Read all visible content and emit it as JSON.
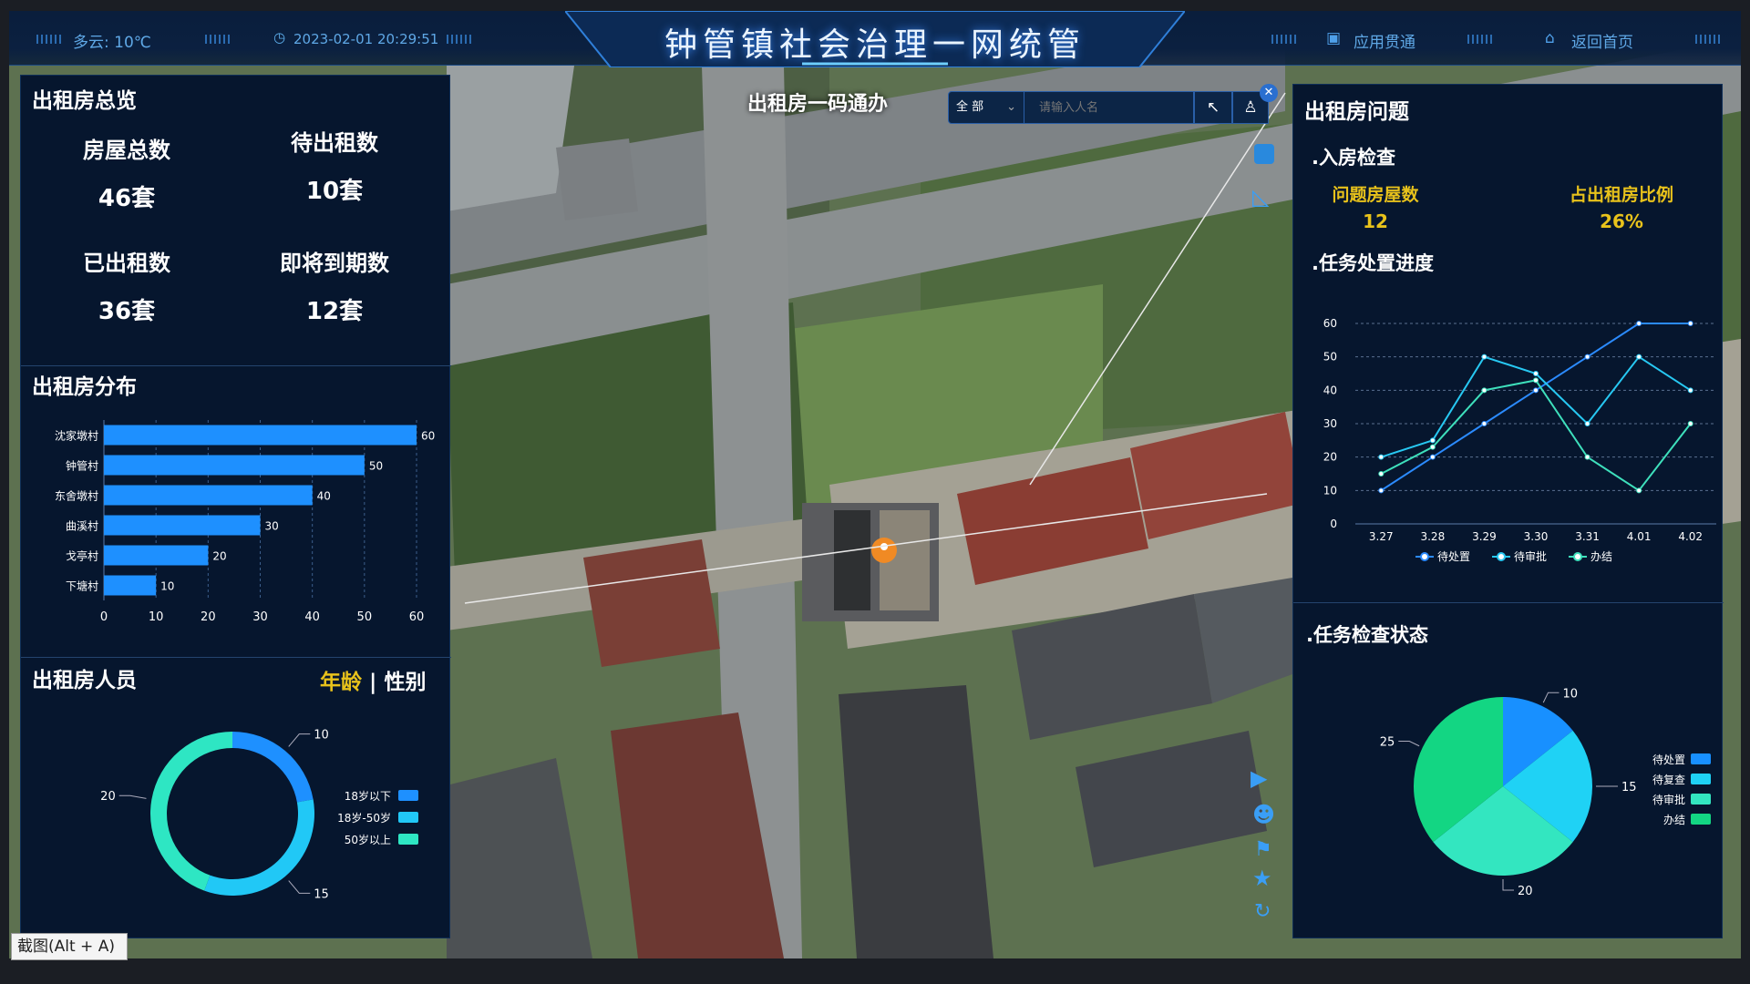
{
  "topbar": {
    "weather": "多云: 10℃",
    "datetime": "2023-02-01 20:29:51",
    "title": "钟管镇社会治理一网统管",
    "app_nav": "应用贯通",
    "home": "返回首页"
  },
  "map_overlay": {
    "title": "出租房一码通办",
    "select_value": "全 部",
    "search_placeholder": "请输入人名"
  },
  "overview": {
    "title": "出租房总览",
    "stats": [
      {
        "label": "房屋总数",
        "value": "46套"
      },
      {
        "label": "待出租数",
        "value": "10套"
      },
      {
        "label": "已出租数",
        "value": "36套"
      },
      {
        "label": "即将到期数",
        "value": "12套"
      }
    ]
  },
  "distribution": {
    "title": "出租房分布",
    "chart_data": {
      "type": "bar",
      "orientation": "horizontal",
      "categories": [
        "沈家墩村",
        "钟管村",
        "东舍墩村",
        "曲溪村",
        "戈亭村",
        "下塘村"
      ],
      "values": [
        60,
        50,
        40,
        30,
        20,
        10
      ],
      "xlim": [
        0,
        60
      ],
      "xticks": [
        0,
        10,
        20,
        30,
        40,
        50,
        60
      ],
      "color": "#1e90ff"
    }
  },
  "persons": {
    "title": "出租房人员",
    "tab_age": "年龄",
    "tab_sep": "|",
    "tab_gender": "性别",
    "chart_data": {
      "type": "pie",
      "style": "donut",
      "labels": [
        "18岁以下",
        "18岁-50岁",
        "50岁以上"
      ],
      "values": [
        10,
        15,
        20
      ],
      "colors": [
        "#1e90ff",
        "#21c8f6",
        "#2ee6c3"
      ]
    }
  },
  "issues": {
    "title": "出租房问题",
    "checkin": {
      "title": ".入房检查",
      "problem_label": "问题房屋数",
      "problem_value": "12",
      "ratio_label": "占出租房比例",
      "ratio_value": "26%"
    },
    "progress": {
      "title": ".任务处置进度",
      "chart_data": {
        "type": "line",
        "x": [
          "3.27",
          "3.28",
          "3.29",
          "3.30",
          "3.31",
          "4.01",
          "4.02"
        ],
        "ylim": [
          0,
          60
        ],
        "yticks": [
          0,
          10,
          20,
          30,
          40,
          50,
          60
        ],
        "series": [
          {
            "name": "待处置",
            "values": [
              10,
              20,
              30,
              40,
              50,
              60,
              60
            ],
            "color": "#2b8bff"
          },
          {
            "name": "待审批",
            "values": [
              20,
              25,
              50,
              45,
              30,
              50,
              40
            ],
            "color": "#27c8f2"
          },
          {
            "name": "办结",
            "values": [
              15,
              23,
              40,
              43,
              20,
              10,
              30
            ],
            "color": "#3ee0bc"
          }
        ]
      }
    },
    "status": {
      "title": ".任务检查状态",
      "chart_data": {
        "type": "pie",
        "labels": [
          "待处置",
          "待复查",
          "待审批",
          "办结"
        ],
        "values": [
          10,
          15,
          20,
          25
        ],
        "colors": [
          "#1890ff",
          "#1fd2f5",
          "#33e6c0",
          "#13d683"
        ]
      }
    }
  },
  "screenshot_hint": "截图(Alt + A)"
}
